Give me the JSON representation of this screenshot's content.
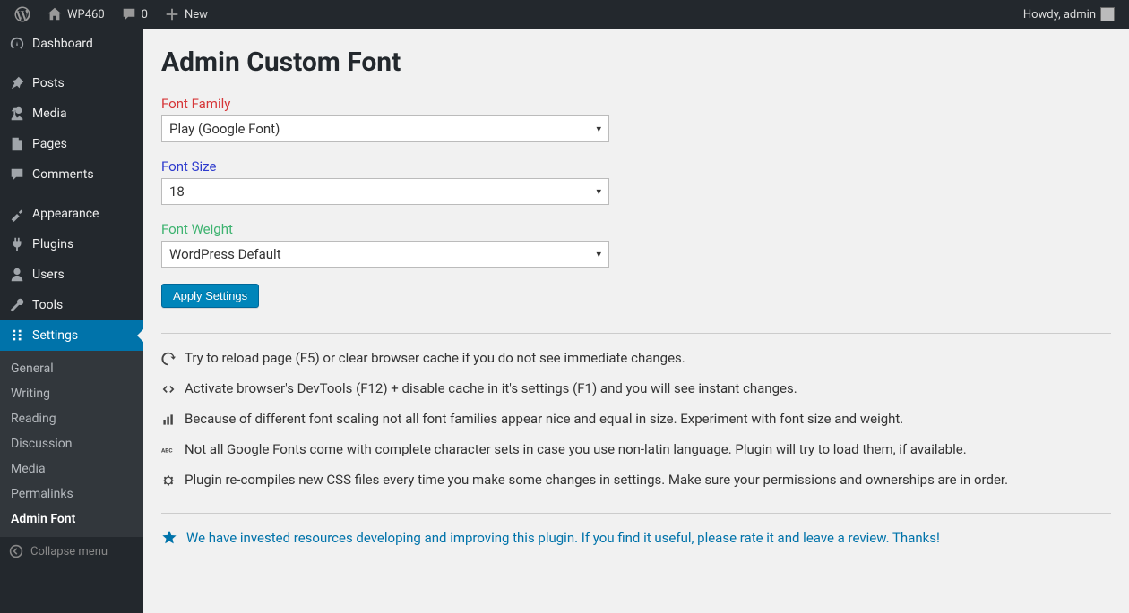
{
  "adminbar": {
    "site_name": "WP460",
    "comments": "0",
    "new": "New",
    "howdy": "Howdy, admin"
  },
  "sidebar": {
    "items": [
      {
        "icon": "dashboard",
        "label": "Dashboard"
      },
      {
        "icon": "pin",
        "label": "Posts"
      },
      {
        "icon": "media",
        "label": "Media"
      },
      {
        "icon": "page",
        "label": "Pages"
      },
      {
        "icon": "comment",
        "label": "Comments"
      },
      {
        "icon": "appearance",
        "label": "Appearance"
      },
      {
        "icon": "plugin",
        "label": "Plugins"
      },
      {
        "icon": "user",
        "label": "Users"
      },
      {
        "icon": "tool",
        "label": "Tools"
      },
      {
        "icon": "settings",
        "label": "Settings"
      }
    ],
    "submenu": [
      "General",
      "Writing",
      "Reading",
      "Discussion",
      "Media",
      "Permalinks",
      "Admin Font"
    ],
    "collapse": "Collapse menu"
  },
  "page": {
    "title": "Admin Custom Font",
    "font_family_label": "Font Family",
    "font_family_value": "Play (Google Font)",
    "font_size_label": "Font Size",
    "font_size_value": "18",
    "font_weight_label": "Font Weight",
    "font_weight_value": "WordPress Default",
    "apply": "Apply Settings",
    "notes": [
      "Try to reload page (F5) or clear browser cache if you do not see immediate changes.",
      "Activate browser's DevTools (F12) + disable cache in it's settings (F1) and you will see instant changes.",
      "Because of different font scaling not all font families appear nice and equal in size. Experiment with font size and weight.",
      "Not all Google Fonts come with complete character sets in case you use non-latin language. Plugin will try to load them, if available.",
      "Plugin re-compiles new CSS files every time you make some changes in settings. Make sure your permissions and ownerships are in order."
    ],
    "promo": "We have invested resources developing and improving this plugin. If you find it useful, please rate it and leave a review. Thanks!"
  }
}
